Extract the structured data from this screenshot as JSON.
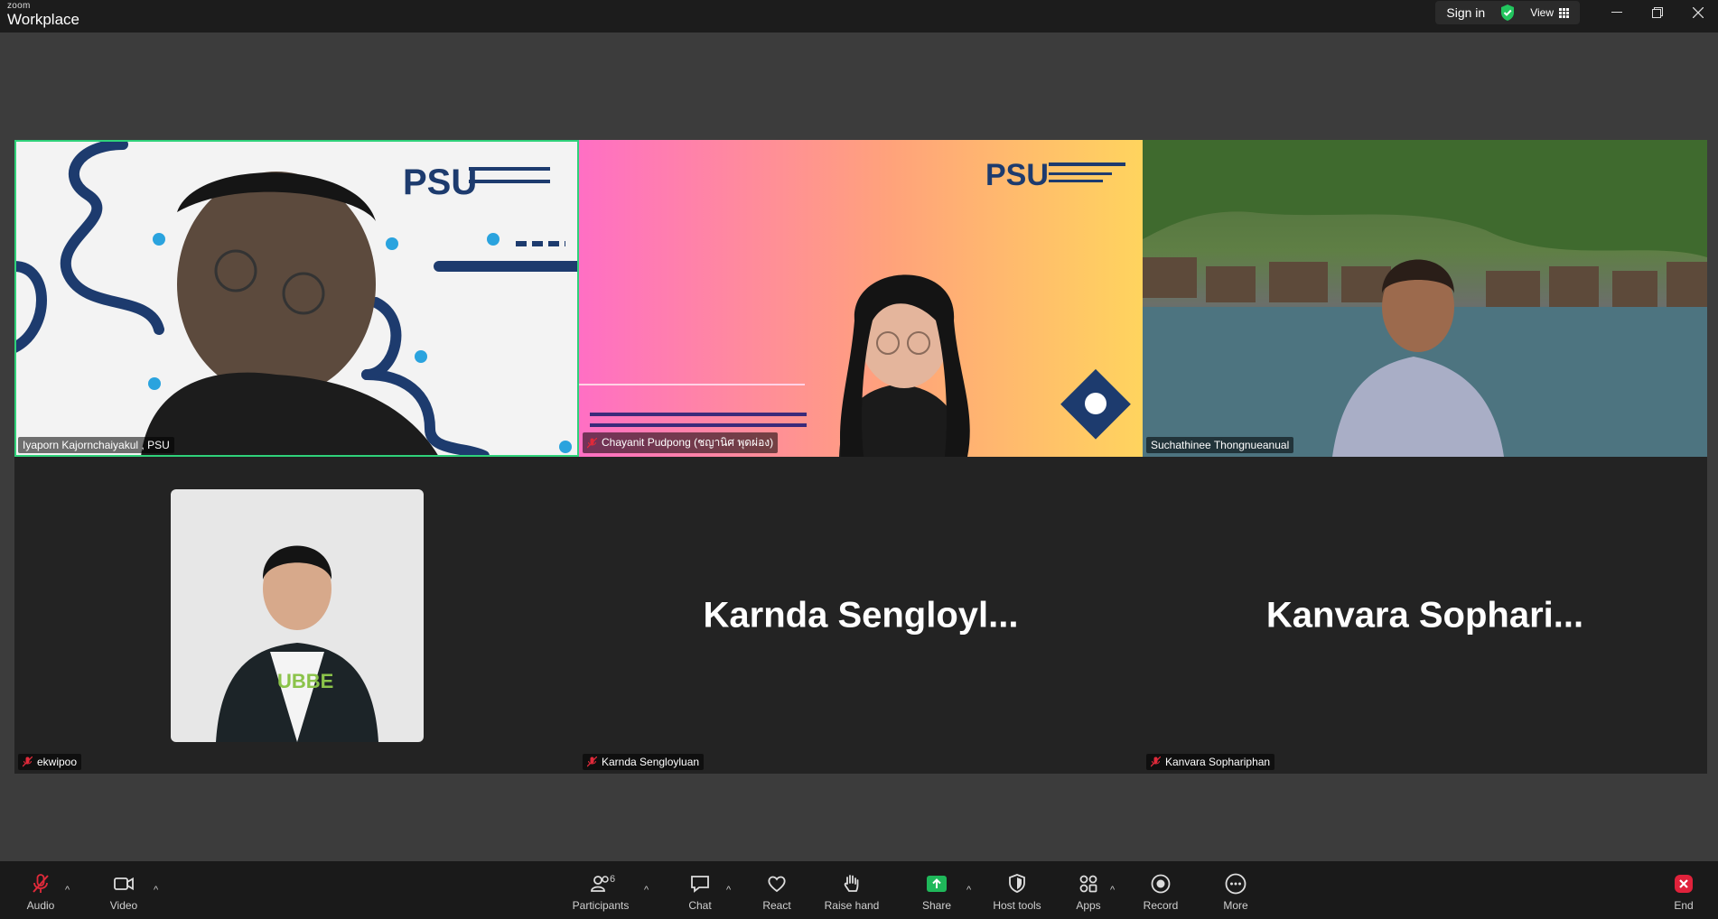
{
  "app": {
    "brand_small": "zoom",
    "brand_big": "Workplace"
  },
  "titlebar": {
    "signin": "Sign in",
    "view": "View"
  },
  "colors": {
    "active_border": "#2fd17a",
    "share_green": "#1fb85a",
    "end_red": "#e0223b"
  },
  "tiles": [
    {
      "name": "Iyaporn Kajornchaiyakul , PSU",
      "muted": false,
      "active": true
    },
    {
      "name": "Chayanit Pudpong (ชญานิศ พุดผ่อง)",
      "muted": true,
      "active": false
    },
    {
      "name": "Suchathinee Thongnueanual",
      "muted": false,
      "active": false
    },
    {
      "name": "ekwipoo",
      "muted": true,
      "active": false
    },
    {
      "name": "Karnda Sengloyluan",
      "display_name": "Karnda  Sengloyl...",
      "muted": true,
      "active": false
    },
    {
      "name": "Kanvara Sophariphan",
      "display_name": "Kanvara  Sophari...",
      "muted": true,
      "active": false
    }
  ],
  "toolbar": {
    "audio": "Audio",
    "video": "Video",
    "participants": "Participants",
    "participants_count": "6",
    "chat": "Chat",
    "react": "React",
    "raise_hand": "Raise hand",
    "share": "Share",
    "host_tools": "Host tools",
    "apps": "Apps",
    "record": "Record",
    "more": "More",
    "end": "End"
  }
}
